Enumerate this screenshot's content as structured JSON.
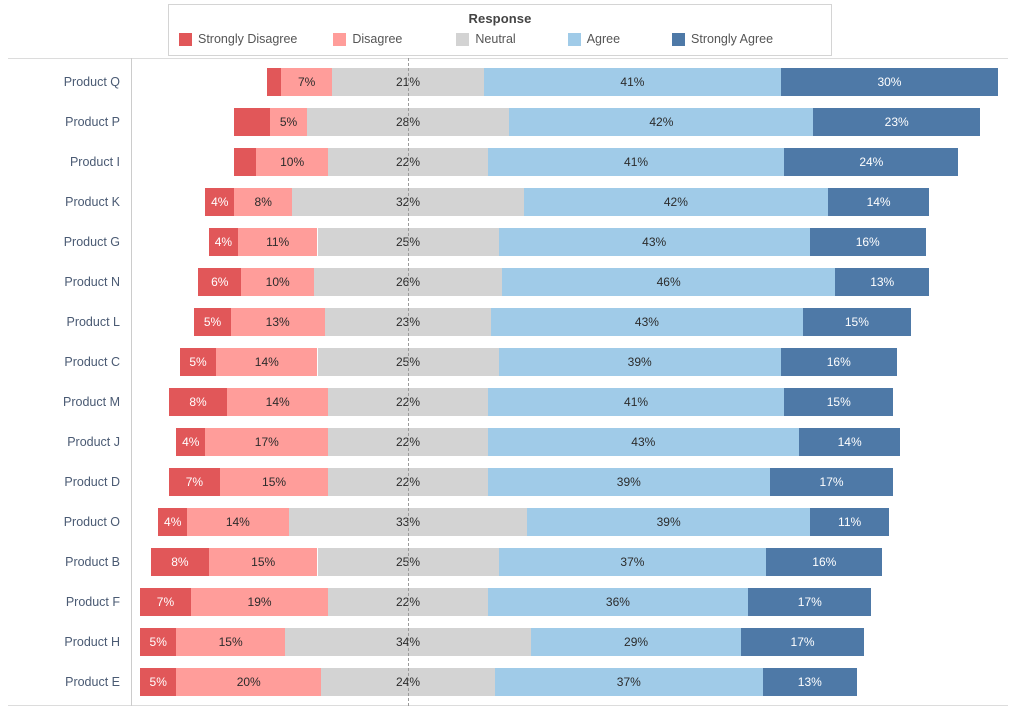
{
  "legend": {
    "title": "Response",
    "items": [
      {
        "label": "Strongly Disagree",
        "color": "#e15759"
      },
      {
        "label": "Disagree",
        "color": "#ff9d9a"
      },
      {
        "label": "Neutral",
        "color": "#d3d3d3"
      },
      {
        "label": "Agree",
        "color": "#a0cbe8"
      },
      {
        "label": "Strongly Agree",
        "color": "#4e79a7"
      }
    ]
  },
  "chart_data": {
    "type": "bar",
    "subtype": "diverging-stacked-bar",
    "title": "",
    "xlabel": "",
    "ylabel": "",
    "grid": false,
    "legend_position": "top",
    "legend_title": "Response",
    "value_suffix": "%",
    "series_order": [
      "Strongly Disagree",
      "Disagree",
      "Neutral",
      "Agree",
      "Strongly Agree"
    ],
    "colors": [
      "#e15759",
      "#ff9d9a",
      "#d3d3d3",
      "#a0cbe8",
      "#4e79a7"
    ],
    "categories": [
      "Product Q",
      "Product P",
      "Product I",
      "Product K",
      "Product G",
      "Product N",
      "Product L",
      "Product C",
      "Product M",
      "Product J",
      "Product D",
      "Product O",
      "Product B",
      "Product F",
      "Product H",
      "Product E"
    ],
    "series": [
      {
        "name": "Strongly Disagree",
        "values": [
          2,
          5,
          3,
          4,
          4,
          6,
          5,
          5,
          8,
          4,
          7,
          4,
          8,
          7,
          5,
          5
        ]
      },
      {
        "name": "Disagree",
        "values": [
          7,
          5,
          10,
          8,
          11,
          10,
          13,
          14,
          14,
          17,
          15,
          14,
          15,
          19,
          15,
          20
        ]
      },
      {
        "name": "Neutral",
        "values": [
          21,
          28,
          22,
          32,
          25,
          26,
          23,
          25,
          22,
          22,
          22,
          33,
          25,
          22,
          34,
          24
        ]
      },
      {
        "name": "Agree",
        "values": [
          41,
          42,
          41,
          42,
          43,
          46,
          43,
          39,
          41,
          43,
          39,
          39,
          37,
          36,
          29,
          37
        ]
      },
      {
        "name": "Strongly Agree",
        "values": [
          30,
          23,
          24,
          14,
          16,
          13,
          15,
          16,
          15,
          14,
          17,
          11,
          16,
          17,
          17,
          13
        ]
      }
    ],
    "rows": [
      {
        "category": "Product Q",
        "values": [
          2,
          7,
          21,
          41,
          30
        ],
        "labels": [
          "",
          "7%",
          "21%",
          "41%",
          "30%"
        ]
      },
      {
        "category": "Product P",
        "values": [
          5,
          5,
          28,
          42,
          23
        ],
        "labels": [
          "",
          "5%",
          "28%",
          "42%",
          "23%"
        ]
      },
      {
        "category": "Product I",
        "values": [
          3,
          10,
          22,
          41,
          24
        ],
        "labels": [
          "",
          "10%",
          "22%",
          "41%",
          "24%"
        ]
      },
      {
        "category": "Product K",
        "values": [
          4,
          8,
          32,
          42,
          14
        ],
        "labels": [
          "4%",
          "8%",
          "32%",
          "42%",
          "14%"
        ]
      },
      {
        "category": "Product G",
        "values": [
          4,
          11,
          25,
          43,
          16
        ],
        "labels": [
          "4%",
          "11%",
          "25%",
          "43%",
          "16%"
        ]
      },
      {
        "category": "Product N",
        "values": [
          6,
          10,
          26,
          46,
          13
        ],
        "labels": [
          "6%",
          "10%",
          "26%",
          "46%",
          "13%"
        ]
      },
      {
        "category": "Product L",
        "values": [
          5,
          13,
          23,
          43,
          15
        ],
        "labels": [
          "5%",
          "13%",
          "23%",
          "43%",
          "15%"
        ]
      },
      {
        "category": "Product C",
        "values": [
          5,
          14,
          25,
          39,
          16
        ],
        "labels": [
          "5%",
          "14%",
          "25%",
          "39%",
          "16%"
        ]
      },
      {
        "category": "Product M",
        "values": [
          8,
          14,
          22,
          41,
          15
        ],
        "labels": [
          "8%",
          "14%",
          "22%",
          "41%",
          "15%"
        ]
      },
      {
        "category": "Product J",
        "values": [
          4,
          17,
          22,
          43,
          14
        ],
        "labels": [
          "4%",
          "17%",
          "22%",
          "43%",
          "14%"
        ]
      },
      {
        "category": "Product D",
        "values": [
          7,
          15,
          22,
          39,
          17
        ],
        "labels": [
          "7%",
          "15%",
          "22%",
          "39%",
          "17%"
        ]
      },
      {
        "category": "Product O",
        "values": [
          4,
          14,
          33,
          39,
          11
        ],
        "labels": [
          "4%",
          "14%",
          "33%",
          "39%",
          "11%"
        ]
      },
      {
        "category": "Product B",
        "values": [
          8,
          15,
          25,
          37,
          16
        ],
        "labels": [
          "8%",
          "15%",
          "25%",
          "37%",
          "16%"
        ]
      },
      {
        "category": "Product F",
        "values": [
          7,
          19,
          22,
          36,
          17
        ],
        "labels": [
          "7%",
          "19%",
          "22%",
          "36%",
          "17%"
        ]
      },
      {
        "category": "Product H",
        "values": [
          5,
          15,
          34,
          29,
          17
        ],
        "labels": [
          "5%",
          "15%",
          "34%",
          "29%",
          "17%"
        ]
      },
      {
        "category": "Product E",
        "values": [
          5,
          20,
          24,
          37,
          13
        ],
        "labels": [
          "5%",
          "20%",
          "24%",
          "37%",
          "13%"
        ]
      }
    ]
  }
}
